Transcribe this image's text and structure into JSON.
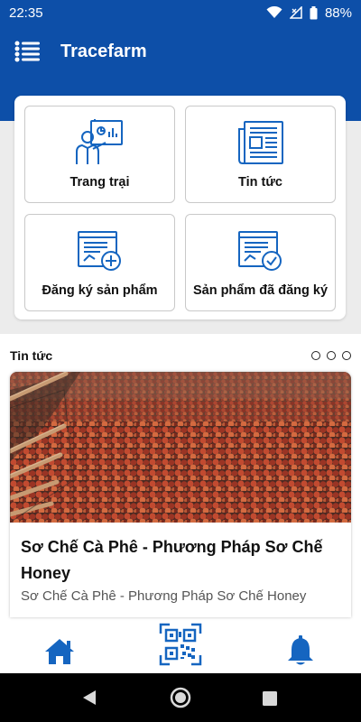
{
  "status_bar": {
    "time": "22:35",
    "battery": "88%"
  },
  "app_bar": {
    "title": "Tracefarm"
  },
  "menu": {
    "items": [
      {
        "label": "Trang trại",
        "icon": "farm-presentation-icon"
      },
      {
        "label": "Tin tức",
        "icon": "newspaper-icon"
      },
      {
        "label": "Đăng ký sản phẩm",
        "icon": "register-product-icon"
      },
      {
        "label": "Sản phẩm đã đăng ký",
        "icon": "registered-product-icon"
      }
    ]
  },
  "news": {
    "section_title": "Tin tức",
    "carousel_pages": 3,
    "article": {
      "title": "Sơ Chế Cà Phê - Phương Pháp Sơ Chế Honey",
      "summary": "Sơ Chế Cà Phê - Phương Pháp Sơ Chế Honey",
      "image": "coffee-cherries-drying-photo"
    }
  },
  "bottom_nav": {
    "items": [
      "home-icon",
      "qr-code-icon",
      "bell-icon"
    ]
  },
  "colors": {
    "primary": "#0d4fa8",
    "icon_blue": "#1565c0",
    "background": "#ececec"
  }
}
